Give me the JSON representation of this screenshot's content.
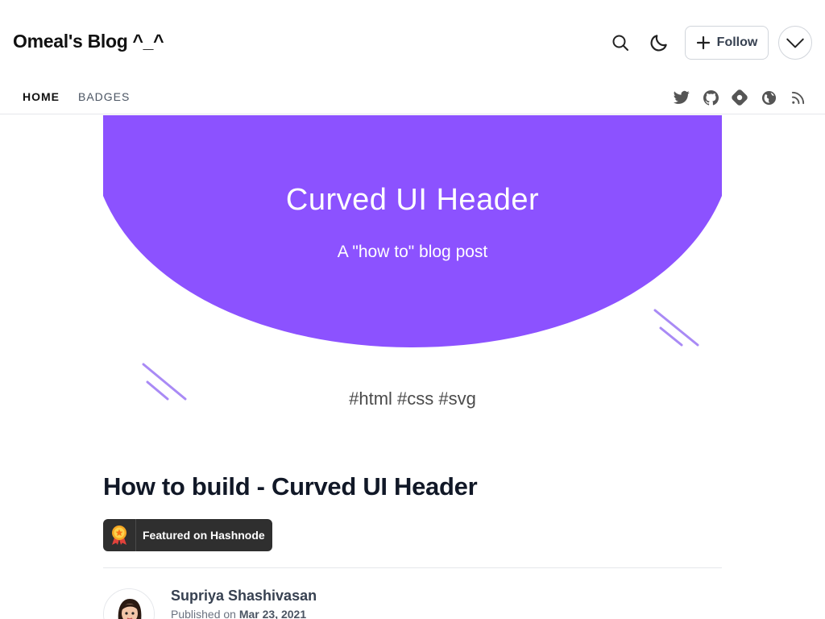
{
  "header": {
    "blog_title": "Omeal's Blog ^_^",
    "follow_label": "Follow"
  },
  "nav": {
    "items": [
      {
        "label": "HOME",
        "active": true
      },
      {
        "label": "BADGES",
        "active": false
      }
    ],
    "social_icons": [
      "twitter-icon",
      "github-icon",
      "hashnode-icon",
      "globe-icon",
      "rss-icon"
    ]
  },
  "cover": {
    "title": "Curved UI Header",
    "subtitle": "A \"how to\" blog post",
    "tags": "#html #css #svg",
    "accent_color": "#8c52ff"
  },
  "article": {
    "title": "How to build - Curved UI Header",
    "featured_label": "Featured on Hashnode",
    "author": "Supriya Shashivasan",
    "published_prefix": "Published on",
    "published_date": "Mar 23, 2021"
  }
}
